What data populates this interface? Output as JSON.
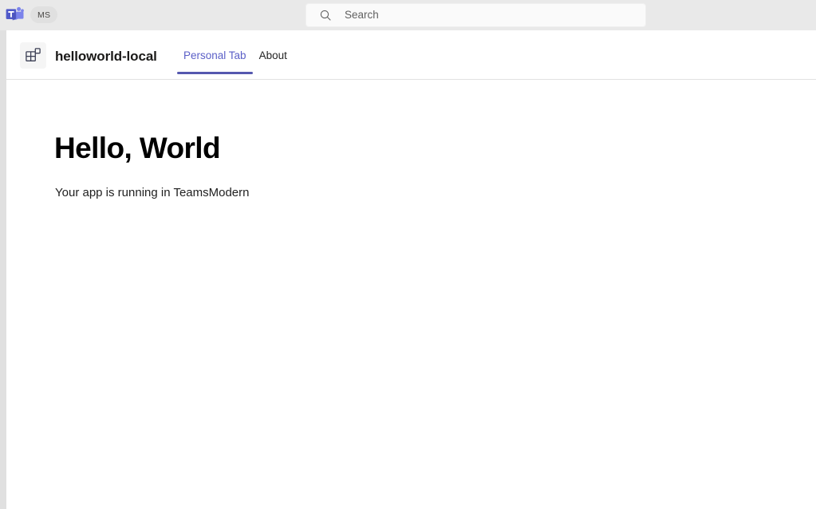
{
  "topbar": {
    "logo_icon": "microsoft-teams-logo",
    "account_badge": "MS",
    "search": {
      "icon": "search-icon",
      "placeholder": "Search",
      "value": ""
    }
  },
  "app_header": {
    "app_icon": "apps-grid-icon",
    "app_title": "helloworld-local",
    "tabs": [
      {
        "label": "Personal Tab",
        "active": true
      },
      {
        "label": "About",
        "active": false
      }
    ]
  },
  "main": {
    "heading": "Hello, World",
    "subtext": "Your app is running in TeamsModern"
  },
  "colors": {
    "accent": "#5b5fc7",
    "accent_underline": "#5558af",
    "topbar_bg": "#e9e9e9",
    "rail_bg": "#e0e0e0",
    "content_bg": "#ffffff",
    "divider": "#e1e1e1",
    "text_primary": "#1b1a19",
    "text_secondary": "#616161"
  }
}
